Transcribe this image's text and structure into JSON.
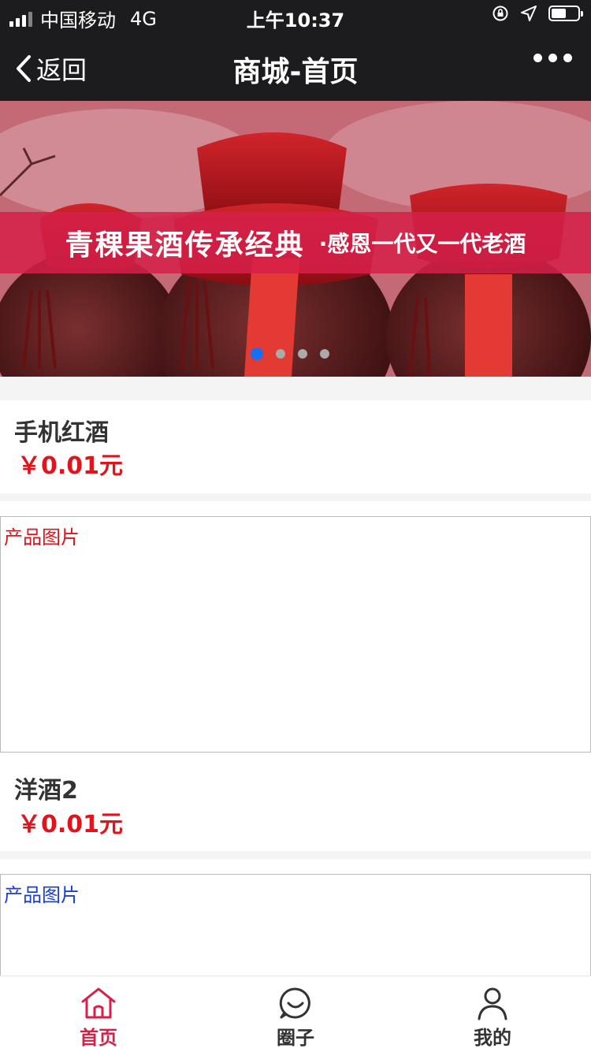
{
  "status": {
    "carrier": "中国移动",
    "network": "4G",
    "time": "上午10:37"
  },
  "nav": {
    "back_label": "返回",
    "title": "商城-首页"
  },
  "banner": {
    "headline": "青稞果酒传承经典",
    "subline": "·感恩一代又一代老酒",
    "dots": 4,
    "active_index": 0
  },
  "products": [
    {
      "name": "手机红酒",
      "price": "￥0.01元"
    },
    {
      "image_placeholder": "产品图片",
      "placeholder_color": "#e0141c",
      "name": "洋酒2",
      "price": "￥0.01元"
    },
    {
      "image_placeholder": "产品图片",
      "placeholder_color": "#1a3ed6"
    }
  ],
  "tabs": [
    {
      "label": "首页",
      "icon": "home-icon",
      "active": true
    },
    {
      "label": "圈子",
      "icon": "chat-icon",
      "active": false
    },
    {
      "label": "我的",
      "icon": "user-icon",
      "active": false
    }
  ],
  "colors": {
    "accent": "#d6204a",
    "price": "#e0141c",
    "dark_bar": "#1c1c1e"
  }
}
